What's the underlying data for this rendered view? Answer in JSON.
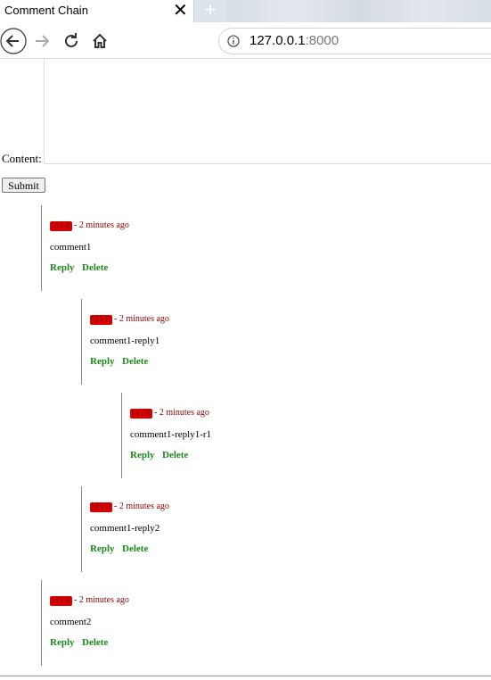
{
  "browser": {
    "tab_title": "Comment Chain",
    "close_glyph": "✕",
    "new_tab_glyph": "+",
    "url_host": "127.0.0.1",
    "url_port": ":8000"
  },
  "form": {
    "content_label": "Content:",
    "content_value": "",
    "submit_label": "Submit"
  },
  "comments": [
    {
      "author": "MVR",
      "time": "- 2 minutes ago",
      "text": "comment1",
      "reply": "Reply",
      "delete": "Delete"
    },
    {
      "author": "MVR",
      "time": "- 2 minutes ago",
      "text": "comment1-reply1",
      "reply": "Reply",
      "delete": "Delete"
    },
    {
      "author": "MVR",
      "time": "- 2 minutes ago",
      "text": "comment1-reply1-r1",
      "reply": "Reply",
      "delete": "Delete"
    },
    {
      "author": "MVR",
      "time": "- 2 minutes ago",
      "text": "comment1-reply2",
      "reply": "Reply",
      "delete": "Delete"
    },
    {
      "author": "MVR",
      "time": "- 2 minutes ago",
      "text": "comment2",
      "reply": "Reply",
      "delete": "Delete"
    }
  ],
  "colors": {
    "author_highlight": "#dd0000",
    "timestamp": "#8b0000",
    "action_link": "#1a8a1a"
  }
}
